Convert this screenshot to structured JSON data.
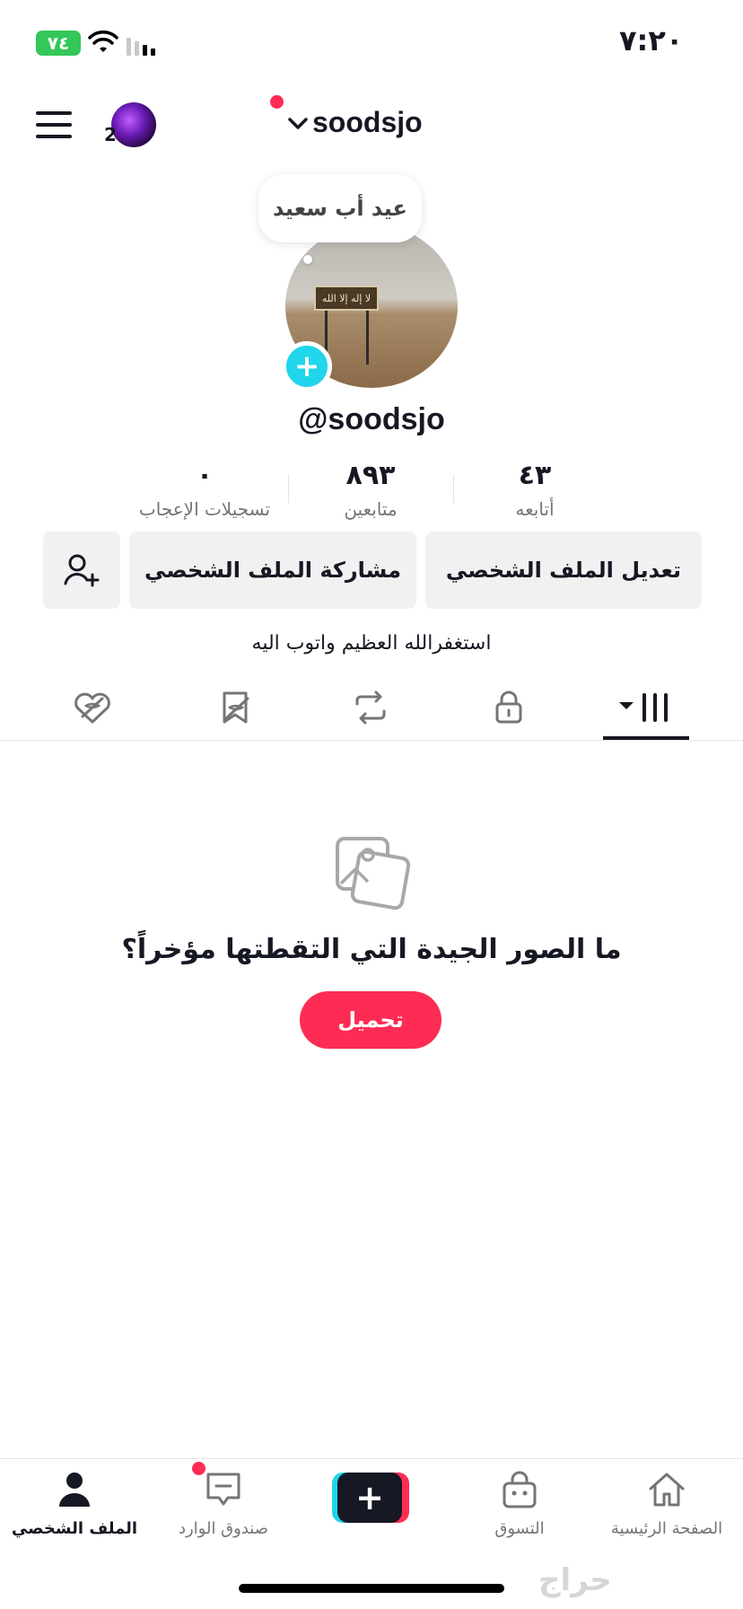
{
  "status_bar": {
    "time": "٧:٢٠",
    "battery": "٧٤"
  },
  "header": {
    "username": "soodsjo",
    "notification_count": "2"
  },
  "profile": {
    "bubble_note": "عيد أب سعيد",
    "photo_sign_text": "لا إله إلا الله",
    "handle": "@soodsjo",
    "bio": "استغفرالله العظيم واتوب اليه"
  },
  "stats": {
    "following": {
      "value": "٤٣",
      "label": "أتابعه"
    },
    "followers": {
      "value": "٨٩٣",
      "label": "متابعين"
    },
    "likes": {
      "value": "٠",
      "label": "تسجيلات الإعجاب"
    }
  },
  "actions": {
    "edit_profile": "تعديل الملف الشخصي",
    "share_profile": "مشاركة الملف الشخصي"
  },
  "tabs": [
    "videos-grid-icon",
    "lock-icon",
    "repost-icon",
    "favorites-icon",
    "liked-icon"
  ],
  "empty_state": {
    "prompt": "ما الصور الجيدة التي التقطتها مؤخراً؟",
    "upload_label": "تحميل"
  },
  "nav": {
    "home": "الصفحة الرئيسية",
    "shop": "التسوق",
    "inbox": "صندوق الوارد",
    "profile": "الملف الشخصي"
  },
  "colors": {
    "accent": "#fe2c55",
    "cyan": "#20d5ec",
    "text": "#161823",
    "battery": "#34c759"
  },
  "watermark": "حراج"
}
